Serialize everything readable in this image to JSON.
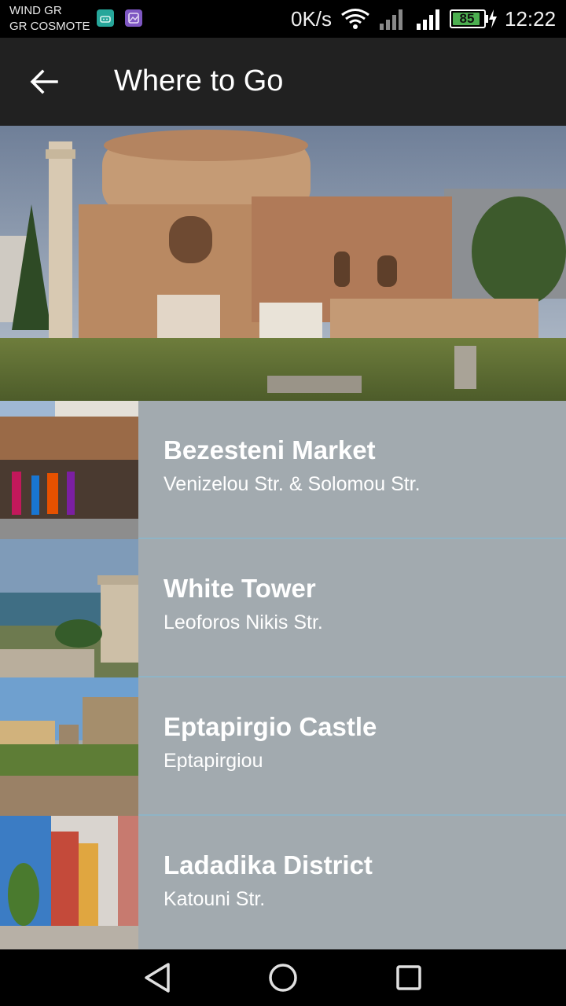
{
  "status_bar": {
    "carrier_line1": "WIND GR",
    "carrier_line2": "GR COSMOTE",
    "net_speed": "0K/s",
    "battery_level": "85",
    "time": "12:22"
  },
  "app_bar": {
    "title": "Where to Go"
  },
  "places": [
    {
      "title": "Bezesteni Market",
      "subtitle": "Venizelou Str. & Solomou Str."
    },
    {
      "title": "White Tower",
      "subtitle": "Leoforos Nikis Str."
    },
    {
      "title": "Eptapirgio Castle",
      "subtitle": "Eptapirgiou"
    },
    {
      "title": "Ladadika District",
      "subtitle": "Katouni Str."
    }
  ],
  "icons": {
    "back": "arrow-back-icon",
    "nav_back": "triangle-back-icon",
    "nav_home": "circle-home-icon",
    "nav_recent": "square-recent-icon"
  },
  "colors": {
    "app_bar_bg": "#212121",
    "list_item_bg": "#a2aaaf",
    "divider": "#8fb4c6",
    "battery_fill": "#4caf50"
  }
}
